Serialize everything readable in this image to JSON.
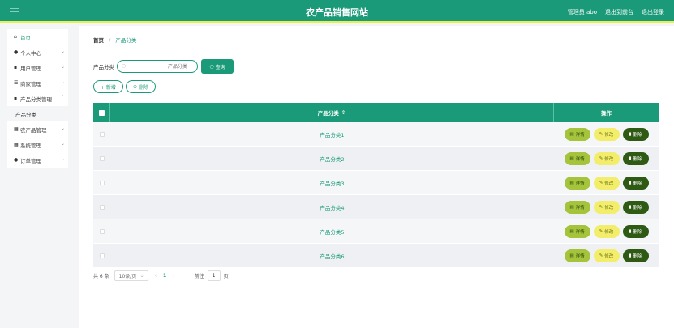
{
  "header": {
    "title": "农产品销售网站",
    "right_links": [
      "管理员 abo",
      "退出到前台",
      "退出登录"
    ]
  },
  "sidebar": {
    "items": [
      {
        "label": "首页",
        "icon": "home-icon",
        "has_chevron": false,
        "active": true
      },
      {
        "label": "个人中心",
        "icon": "user-icon",
        "has_chevron": true
      },
      {
        "label": "用户管理",
        "icon": "clipboard-icon",
        "has_chevron": true
      },
      {
        "label": "商家管理",
        "icon": "sliders-icon",
        "has_chevron": true
      },
      {
        "label": "产品分类管理",
        "icon": "clipboard-icon",
        "has_chevron": true
      }
    ],
    "submenu": [
      "产品分类"
    ],
    "items_after": [
      {
        "label": "农产品管理",
        "icon": "grid-icon",
        "has_chevron": true
      },
      {
        "label": "系统管理",
        "icon": "grid-icon",
        "has_chevron": true
      },
      {
        "label": "订单管理",
        "icon": "user-icon",
        "has_chevron": true
      }
    ]
  },
  "breadcrumb": {
    "home": "首页",
    "separator": "/",
    "current": "产品分类"
  },
  "search": {
    "label": "产品分类",
    "placeholder": "产品分类",
    "button": "查询"
  },
  "actions": {
    "add": "+ 新增",
    "delete": "删除"
  },
  "table": {
    "headers": {
      "name": "产品分类",
      "sort_icon": "⇕",
      "ops": "操作"
    },
    "rows": [
      "产品分类1",
      "产品分类2",
      "产品分类3",
      "产品分类4",
      "产品分类5",
      "产品分类6"
    ],
    "op_labels": {
      "detail": "详情",
      "edit": "修改",
      "del": "删除"
    }
  },
  "pagination": {
    "total": "共 6 条",
    "page_size": "10条/页",
    "current_page": "1",
    "goto_prefix": "前往",
    "goto_value": "1",
    "goto_suffix": "页"
  },
  "colors": {
    "primary": "#1a9a78",
    "accent_bar": "#e8ee54",
    "detail": "#a6c33c",
    "edit": "#f2ee6c",
    "delete": "#2e5a14"
  }
}
